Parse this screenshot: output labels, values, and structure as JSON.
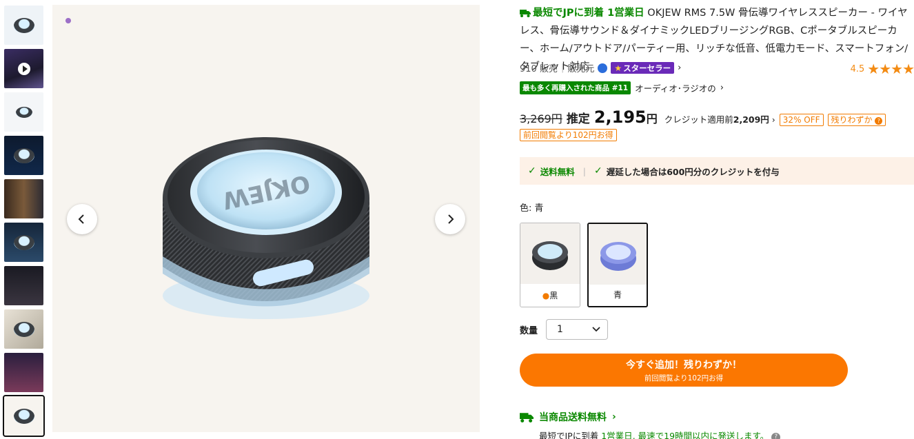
{
  "thumbnails": [
    {
      "kind": "product"
    },
    {
      "kind": "video"
    },
    {
      "kind": "diagram"
    },
    {
      "kind": "dark"
    },
    {
      "kind": "lifestyle"
    },
    {
      "kind": "feature"
    },
    {
      "kind": "dark"
    },
    {
      "kind": "power"
    },
    {
      "kind": "party"
    },
    {
      "kind": "product",
      "active": true
    }
  ],
  "title": {
    "fast_label": "最短でJPに到着 1営業日",
    "text": "OKJEW RMS 7.5W 骨伝導ワイヤレススピーカー - ワイヤレス、骨伝導サウンド＆ダイナミックLEDブリージングRGB、Cポータブルスピーカー、ホーム/アウトドア/パーティー用、リッチな低音、低電力モード、スマートフォン/タブレット対応"
  },
  "sold": "910 販売",
  "seller_prefix": "販売元",
  "star_seller": "スターセラー",
  "rating": {
    "value": "4.5",
    "stars": "★★★★"
  },
  "rank": {
    "badge": "最も多く再購入された商品 #11",
    "category": "オーディオ･ラジオの"
  },
  "price": {
    "old": "3,269円",
    "est_label": "推定",
    "new": "2,195",
    "new_unit": "円",
    "credit_prefix": "クレジット適用前",
    "credit_value": "2,209円",
    "off": "32% OFF",
    "low_stock": "残りわずか",
    "prev_view": "前回閲覧より102円お得"
  },
  "shipping_box": {
    "free": "送料無料",
    "late_credit": "遅延した場合は600円分のクレジットを付与"
  },
  "color": {
    "label": "色: 青",
    "options": [
      {
        "label": "黒",
        "selected": false
      },
      {
        "label": "青",
        "selected": true
      }
    ]
  },
  "quantity": {
    "label": "数量",
    "value": "1"
  },
  "add_button": {
    "main": "今すぐ追加！残りわずか！",
    "sub": "前回閲覧より102円お得"
  },
  "free_ship_title": "当商品送料無料",
  "fast_note": {
    "prefix": "最短でJPに到着",
    "highlight": "1営業日, 最速で19時間以内に発送します。"
  },
  "colors": {
    "accent_orange": "#fb7701",
    "green": "#0a8800",
    "star_purple": "#6a2ab8"
  }
}
